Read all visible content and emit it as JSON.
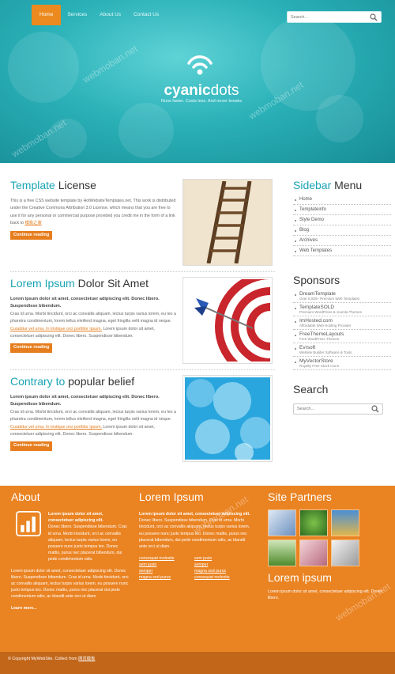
{
  "nav": {
    "items": [
      "Home",
      "Services",
      "About Us",
      "Contact Us"
    ]
  },
  "search": {
    "placeholder": "Search..."
  },
  "brand": {
    "name_bold": "cyanic",
    "name_light": "dots",
    "tagline": "Runs faster. Costs less. And never breaks"
  },
  "watermark": "webmoban.net",
  "articles": [
    {
      "title_hl": "Template",
      "title_rest": " License",
      "body": "This is a free CSS website template by HotWebsiteTemplates.net. This work is distributed under the Creative Commons Attribution 3.0 License, which means that you are free to use it for any personal or commercial purpose provided you credit me in the form of a link back to ",
      "link": "模板之家",
      "button": "Continue reading"
    },
    {
      "title_hl": "Lorem Ipsum",
      "title_rest": " Dolor Sit Amet",
      "lead": "Lorem ipsum dolor sit amet, consectetuer adipiscing elit. Donec libero. Suspendisse bibendum.",
      "body": "Cras id urna. Morbi tincidunt, orci ac convallis aliquam, lectus turpis varius lorem, eu leo a pharetra condimentum, lorem tellus eleifend magna, eget fringilla velit magna id neque. ",
      "link": "Curabitur vel urna. In tristique orci porttitor ipsum.",
      "body2": " Lorem ipsum dolor sit amet, consectetuer adipiscing elit. Donec libero. Suspendisse bibendum.",
      "button": "Continue reading"
    },
    {
      "title_hl": "Contrary to",
      "title_rest": " popular belief",
      "lead": "Lorem ipsum dolor sit amet, consectetuer adipiscing elit. Donec libero. Suspendisse bibendum.",
      "body": "Cras id urna. Morbi tincidunt, orci ac convallis aliquam, lectus turpis varius lorem, eu leo a pharetra condimentum, lorem tellus eleifend magna, eget fringilla velit magna id neque. ",
      "link": "Curabitur vel urna. In tristique orci porttitor ipsum.",
      "body2": " Lorem ipsum dolor sit amet, consectetuer adipiscing elit. Donec libero. Suspendisse bibendum.",
      "button": "Continue reading"
    }
  ],
  "sidebar": {
    "menu_hl": "Sidebar",
    "menu_rest": " Menu",
    "menu": [
      "Home",
      "Templateinfo",
      "Style Demo",
      "Blog",
      "Archives",
      "Web Templates"
    ],
    "sponsors_title": "Sponsors",
    "sponsors": [
      {
        "name": "DreamTemplate",
        "desc": "Over 6,000+ Premium Web Templates"
      },
      {
        "name": "TemplateSOLD",
        "desc": "Premium WordPress & Joomla Themes"
      },
      {
        "name": "ImHosted.com",
        "desc": "Affordable Web Hosting Provider"
      },
      {
        "name": "FreeThemeLayouts",
        "desc": "Free WordPress Themes"
      },
      {
        "name": "Evrsoft",
        "desc": "Website Builder Software & Tools"
      },
      {
        "name": "MyVectorStore",
        "desc": "Royalty Free Stock Icons"
      }
    ],
    "search_title": "Search"
  },
  "footer": {
    "about_title": "About",
    "about_lead": "Lorem ipsum dolor sit amet, consectetuer adipiscing elit.",
    "about_body": "Donec libero. Suspendisse bibendum. Cras id urna. Morbi tincidunt, orci ac convallis aliquam, lectus turpis varius lorem, eu posuere nunc justo tempus leo. Donec mattis, purus nec placerat bibendum, dui pede condimentum odio.",
    "about_body2": "Lorem ipsum dolor sit amet, consectetuer adipiscing elit. Donec libero. Suspendisse bibendum. Cras id urna. Morbi tincidunt, orci ac convallis aliquam, lectus turpis varius lorem, eu posuere nunc justo tempus leo. Donec mattis, purus nec placerat dui pede condimentum odio, ac blandit ante orci ut diam.",
    "about_more": "Learn more...",
    "ipsum_title": "Lorem Ipsum",
    "ipsum_lead": "Lorem ipsum dolor sit amet, consectetuer adipiscing elit.",
    "ipsum_body": "Donec libero. Suspendisse bibendum. Cras id urna. Morbi tincidunt, orci ac convallis aliquam, lectus turpis varius lorem, eu posuere nunc justo tempus leo. Donec mattis, purus nec placerat bibendum, dui pede condimentum odio, ac blandit ante orci ut diam.",
    "ipsum_links": [
      "consequat molestie",
      "sem justo",
      "sem justo",
      "semper",
      "semper",
      "magna sed purus",
      "magna sed purus",
      "consequat molestie"
    ],
    "partners_title": "Site Partners",
    "ipsum2_title": "Lorem ipsum",
    "ipsum2_body": "Lorem ipsum dolor sit amet, consectetuer adipiscing elit. Donec libero."
  },
  "copyright": {
    "text": "© Copyright MyWebSite. Collect from ",
    "link": "网页模板"
  }
}
